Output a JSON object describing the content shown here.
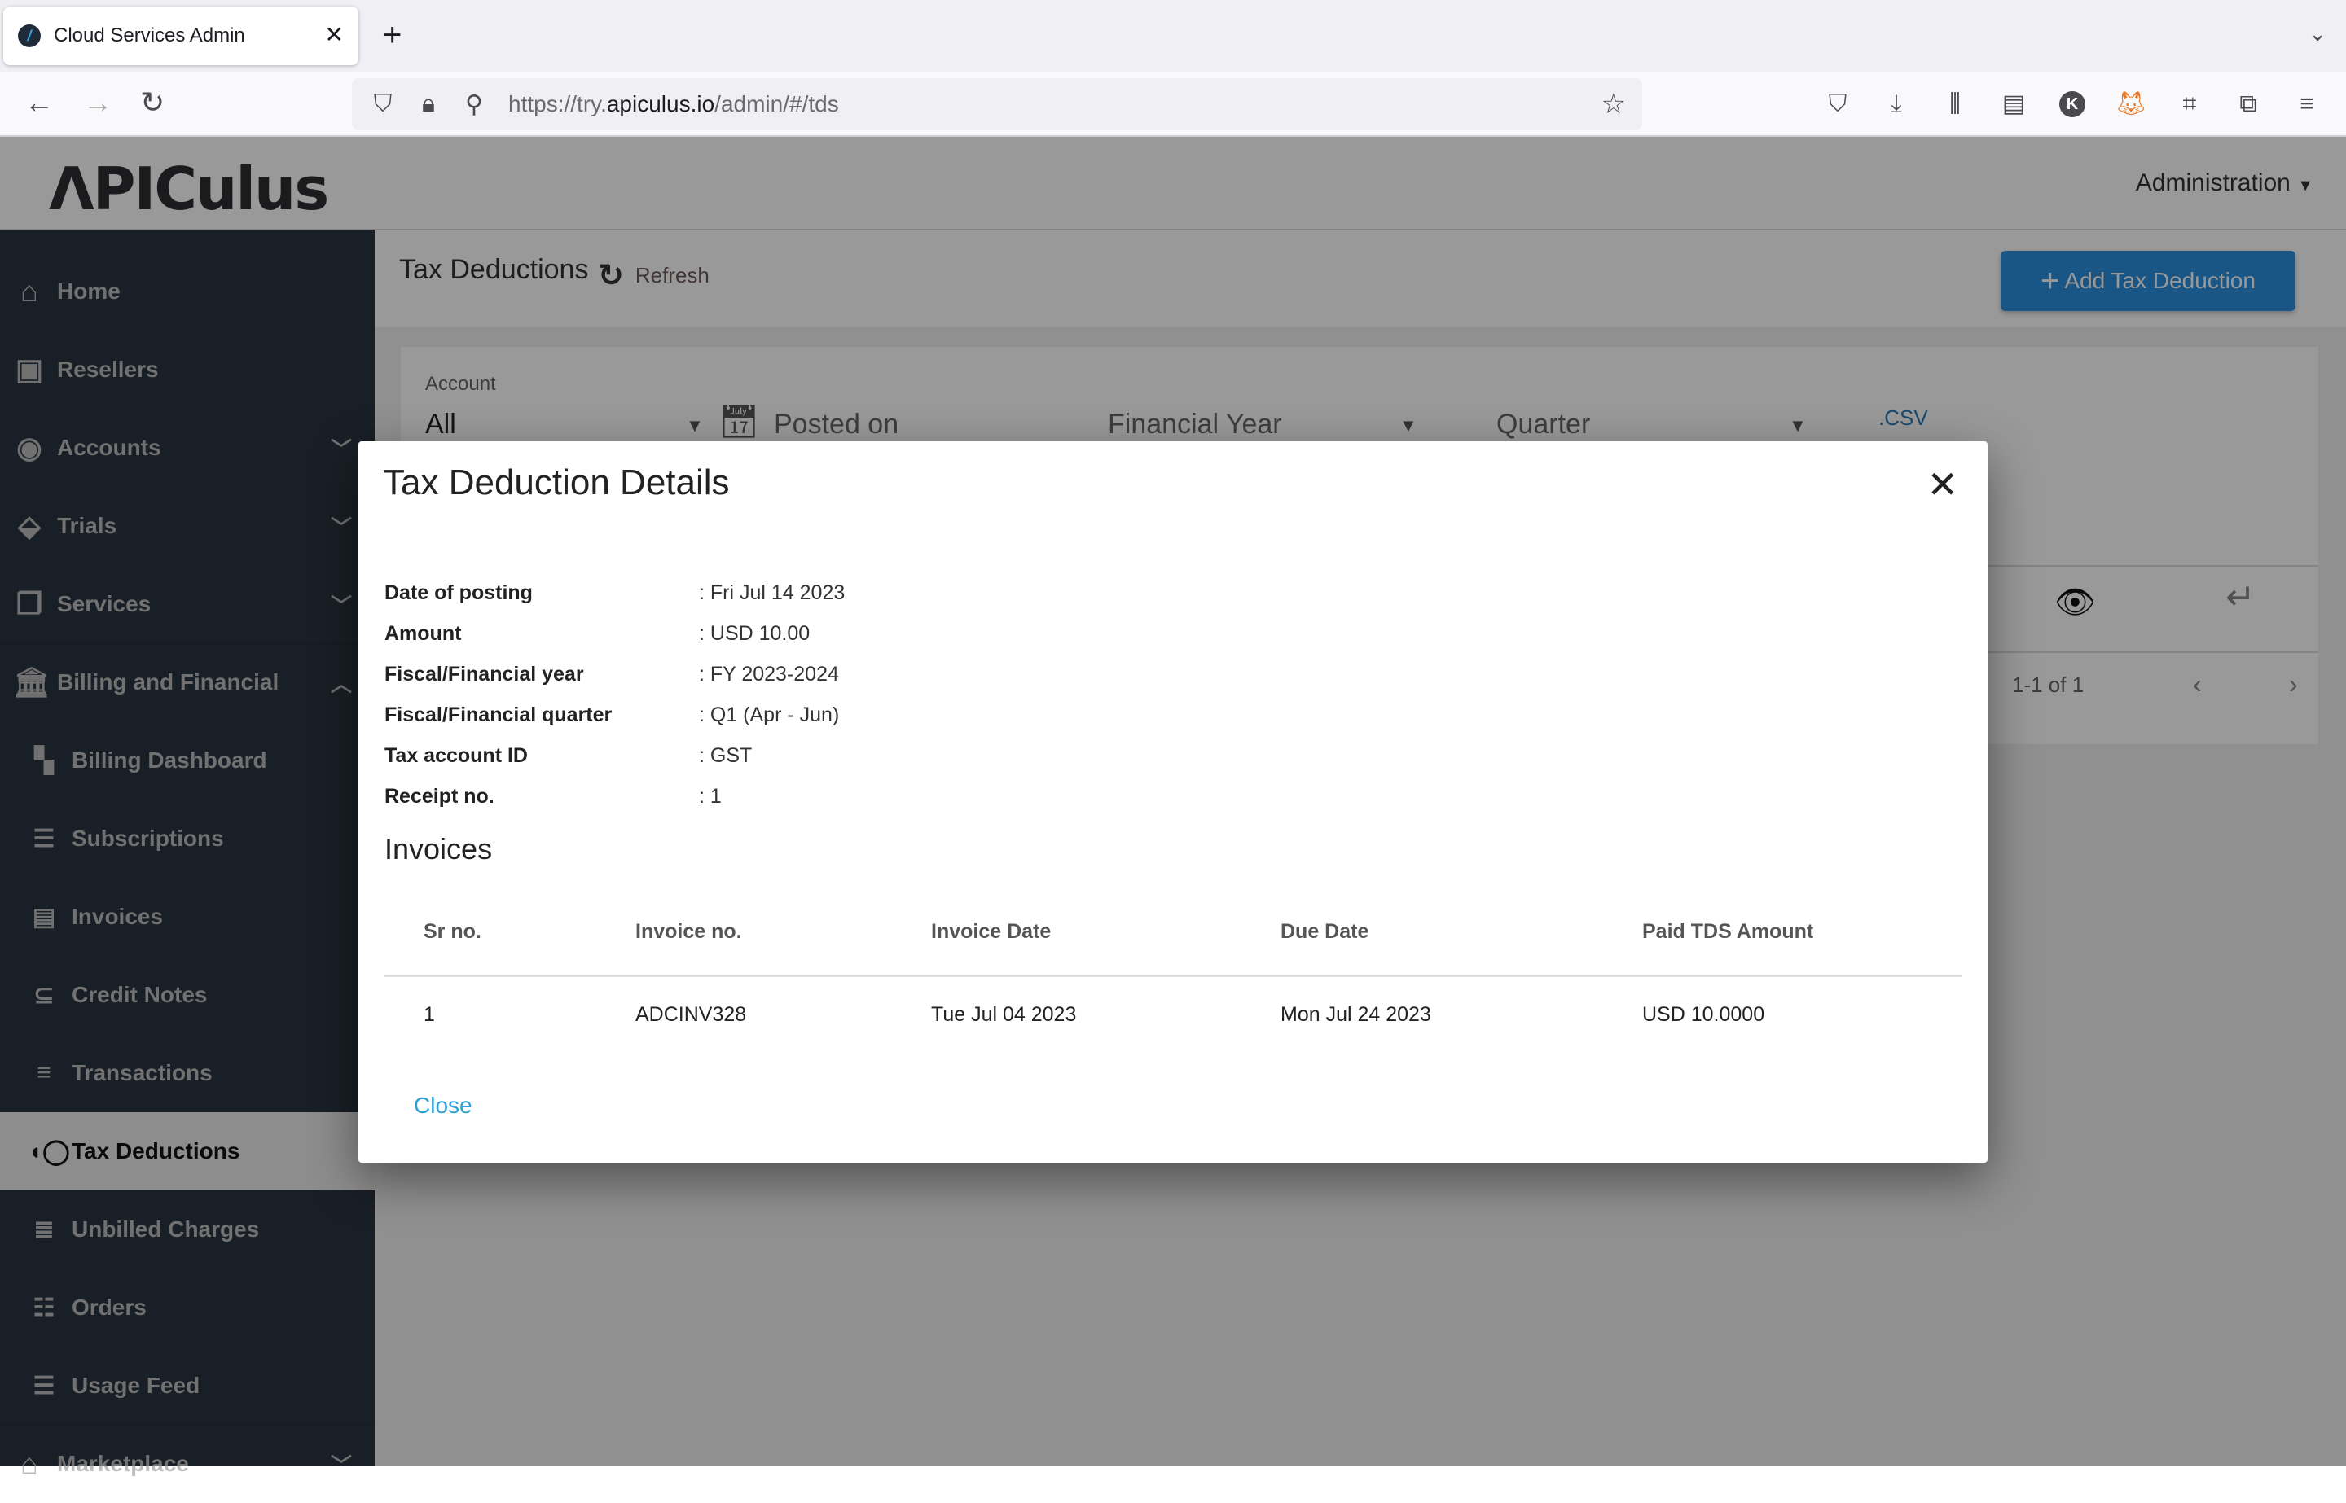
{
  "browser": {
    "tab_title": "Cloud Services Admin",
    "tab_favicon": "apiculus-logo-icon",
    "url_prefix": "https://try.",
    "url_domain": "apiculus.io",
    "url_path": "/admin/#/tds",
    "toolbar_icons": [
      "pocket-icon",
      "download-icon",
      "library-icon",
      "sidebar-icon",
      "account-k-icon",
      "metamask-fox-icon",
      "crop-icon",
      "extensions-icon",
      "menu-icon"
    ],
    "account_initial": "K"
  },
  "app": {
    "logo": "ΛPICulus",
    "admin_menu": "Administration"
  },
  "sidebar": {
    "items": [
      {
        "label": "Home",
        "icon": "home-icon",
        "expandable": false
      },
      {
        "label": "Resellers",
        "icon": "reseller-icon",
        "expandable": false
      },
      {
        "label": "Accounts",
        "icon": "account-icon",
        "expandable": true
      },
      {
        "label": "Trials",
        "icon": "tag-heart-icon",
        "expandable": true
      },
      {
        "label": "Services",
        "icon": "services-icon",
        "expandable": true
      },
      {
        "label": "Billing and Financial",
        "icon": "bank-icon",
        "expandable": true,
        "expanded": true
      },
      {
        "label": "Billing Dashboard",
        "icon": "dashboard-icon",
        "sub": true
      },
      {
        "label": "Subscriptions",
        "icon": "list-icon",
        "sub": true
      },
      {
        "label": "Invoices",
        "icon": "receipt-icon",
        "sub": true
      },
      {
        "label": "Credit Notes",
        "icon": "credit-notes-icon",
        "sub": true
      },
      {
        "label": "Transactions",
        "icon": "lines-icon",
        "sub": true
      },
      {
        "label": "Tax Deductions",
        "icon": "tax-icon",
        "sub": true,
        "active": true
      },
      {
        "label": "Unbilled Charges",
        "icon": "notes-icon",
        "sub": true
      },
      {
        "label": "Orders",
        "icon": "orders-icon",
        "sub": true
      },
      {
        "label": "Usage Feed",
        "icon": "feed-icon",
        "sub": true
      },
      {
        "label": "Marketplace",
        "icon": "store-icon",
        "expandable": true
      }
    ]
  },
  "page": {
    "title": "Tax Deductions",
    "refresh_label": "Refresh",
    "add_button_label": "Add Tax Deduction",
    "filters": {
      "account_label": "Account",
      "account_value": "All",
      "posted_on_placeholder": "Posted on",
      "financial_year_placeholder": "Financial Year",
      "quarter_placeholder": "Quarter",
      "csv_label": ".CSV"
    },
    "pagination": {
      "range": "1-1 of 1"
    }
  },
  "modal": {
    "title": "Tax Deduction Details",
    "details": [
      {
        "key": "Date of posting",
        "value": ": Fri Jul 14 2023"
      },
      {
        "key": "Amount",
        "value": ": USD 10.00"
      },
      {
        "key": "Fiscal/Financial year",
        "value": ": FY 2023-2024"
      },
      {
        "key": "Fiscal/Financial quarter",
        "value": ": Q1 (Apr - Jun)"
      },
      {
        "key": "Tax account ID",
        "value": ": GST"
      },
      {
        "key": "Receipt no.",
        "value": ": 1"
      }
    ],
    "invoices_title": "Invoices",
    "invoice_columns": [
      "Sr no.",
      "Invoice no.",
      "Invoice Date",
      "Due Date",
      "Paid TDS Amount"
    ],
    "invoice_rows": [
      [
        "1",
        "ADCINV328",
        "Tue Jul 04 2023",
        "Mon Jul 24 2023",
        "USD 10.0000"
      ]
    ],
    "close_label": "Close"
  }
}
